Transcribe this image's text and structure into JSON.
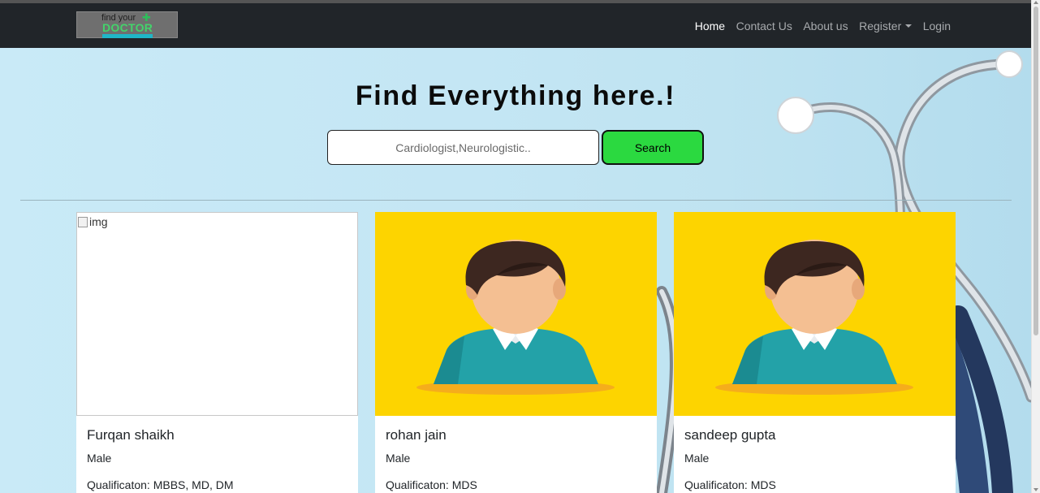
{
  "nav": {
    "logo": {
      "line1": "find your",
      "line2": "DOCTOR"
    },
    "links": [
      "Home",
      "Contact Us",
      "About us",
      "Register",
      "Login"
    ]
  },
  "hero": {
    "title": "Find Everything here.!",
    "search_placeholder": "Cardiologist,Neurologistic..",
    "search_button": "Search"
  },
  "doctors": [
    {
      "name": "Furqan shaikh",
      "gender": "Male",
      "qualification": "Qualificaton: MBBS, MD, DM",
      "image_alt": "img",
      "image": "broken-image"
    },
    {
      "name": "rohan jain",
      "gender": "Male",
      "qualification": "Qualificaton: MDS",
      "image": "avatar-icon"
    },
    {
      "name": "sandeep gupta",
      "gender": "Male",
      "qualification": "Qualificaton: MDS",
      "image": "avatar-icon"
    }
  ],
  "colors": {
    "navbar": "#212529",
    "hero_bg": "#c4e6f4",
    "search_button": "#2bd940",
    "avatar_bg": "#fdd400",
    "avatar_shirt": "#23a2a8"
  }
}
